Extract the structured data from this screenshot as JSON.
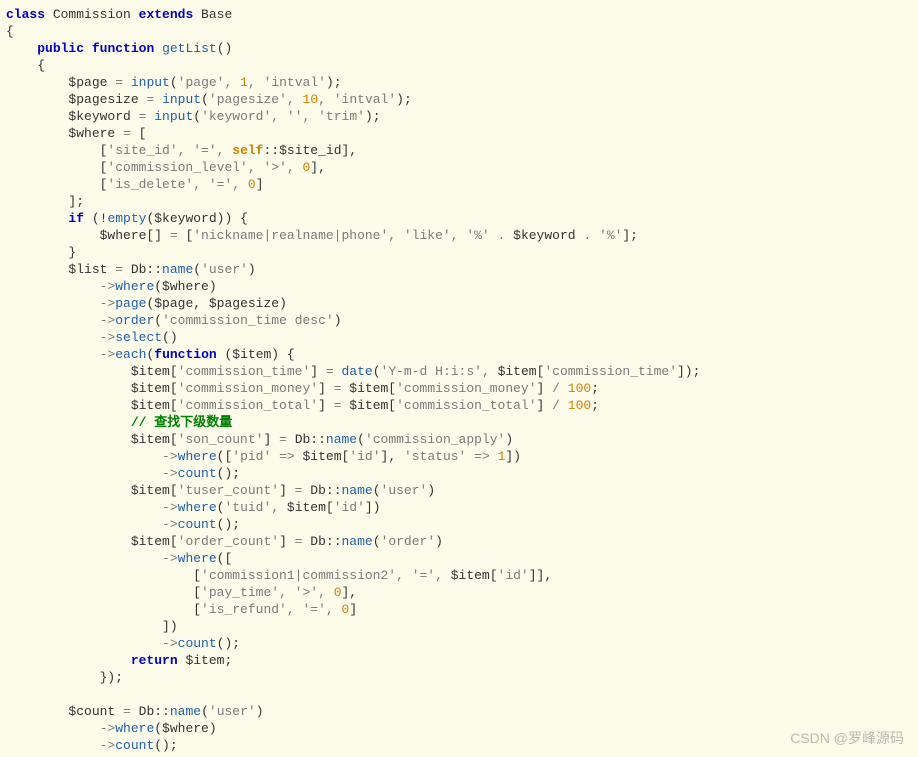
{
  "code": {
    "lines": [
      [
        {
          "c": "kw",
          "t": "class"
        },
        {
          "c": "p",
          "t": " Commission "
        },
        {
          "c": "kw",
          "t": "extends"
        },
        {
          "c": "p",
          "t": " Base"
        }
      ],
      [
        {
          "c": "p",
          "t": "{"
        }
      ],
      [
        {
          "c": "p",
          "t": "    "
        },
        {
          "c": "kw",
          "t": "public"
        },
        {
          "c": "p",
          "t": " "
        },
        {
          "c": "kw",
          "t": "function"
        },
        {
          "c": "p",
          "t": " "
        },
        {
          "c": "fn",
          "t": "getList"
        },
        {
          "c": "p",
          "t": "()"
        }
      ],
      [
        {
          "c": "p",
          "t": "    {"
        }
      ],
      [
        {
          "c": "p",
          "t": "        $page "
        },
        {
          "c": "gy",
          "t": "="
        },
        {
          "c": "p",
          "t": " "
        },
        {
          "c": "fn",
          "t": "input"
        },
        {
          "c": "p",
          "t": "("
        },
        {
          "c": "str",
          "t": "'page'"
        },
        {
          "c": "gy",
          "t": ", "
        },
        {
          "c": "num",
          "t": "1"
        },
        {
          "c": "gy",
          "t": ", "
        },
        {
          "c": "str",
          "t": "'intval'"
        },
        {
          "c": "p",
          "t": ");"
        }
      ],
      [
        {
          "c": "p",
          "t": "        $pagesize "
        },
        {
          "c": "gy",
          "t": "="
        },
        {
          "c": "p",
          "t": " "
        },
        {
          "c": "fn",
          "t": "input"
        },
        {
          "c": "p",
          "t": "("
        },
        {
          "c": "str",
          "t": "'pagesize'"
        },
        {
          "c": "gy",
          "t": ", "
        },
        {
          "c": "num",
          "t": "10"
        },
        {
          "c": "gy",
          "t": ", "
        },
        {
          "c": "str",
          "t": "'intval'"
        },
        {
          "c": "p",
          "t": ");"
        }
      ],
      [
        {
          "c": "p",
          "t": "        $keyword "
        },
        {
          "c": "gy",
          "t": "="
        },
        {
          "c": "p",
          "t": " "
        },
        {
          "c": "fn",
          "t": "input"
        },
        {
          "c": "p",
          "t": "("
        },
        {
          "c": "str",
          "t": "'keyword'"
        },
        {
          "c": "gy",
          "t": ", "
        },
        {
          "c": "str",
          "t": "''"
        },
        {
          "c": "gy",
          "t": ", "
        },
        {
          "c": "str",
          "t": "'trim'"
        },
        {
          "c": "p",
          "t": ");"
        }
      ],
      [
        {
          "c": "p",
          "t": "        $where "
        },
        {
          "c": "gy",
          "t": "="
        },
        {
          "c": "p",
          "t": " ["
        }
      ],
      [
        {
          "c": "p",
          "t": "            ["
        },
        {
          "c": "str",
          "t": "'site_id'"
        },
        {
          "c": "gy",
          "t": ", "
        },
        {
          "c": "str",
          "t": "'='"
        },
        {
          "c": "gy",
          "t": ", "
        },
        {
          "c": "or",
          "t": "self"
        },
        {
          "c": "p",
          "t": "::$site_id],"
        }
      ],
      [
        {
          "c": "p",
          "t": "            ["
        },
        {
          "c": "str",
          "t": "'commission_level'"
        },
        {
          "c": "gy",
          "t": ", "
        },
        {
          "c": "str",
          "t": "'>'"
        },
        {
          "c": "gy",
          "t": ", "
        },
        {
          "c": "num",
          "t": "0"
        },
        {
          "c": "p",
          "t": "],"
        }
      ],
      [
        {
          "c": "p",
          "t": "            ["
        },
        {
          "c": "str",
          "t": "'is_delete'"
        },
        {
          "c": "gy",
          "t": ", "
        },
        {
          "c": "str",
          "t": "'='"
        },
        {
          "c": "gy",
          "t": ", "
        },
        {
          "c": "num",
          "t": "0"
        },
        {
          "c": "p",
          "t": "]"
        }
      ],
      [
        {
          "c": "p",
          "t": "        ];"
        }
      ],
      [
        {
          "c": "p",
          "t": "        "
        },
        {
          "c": "kw",
          "t": "if"
        },
        {
          "c": "p",
          "t": " (!"
        },
        {
          "c": "fn",
          "t": "empty"
        },
        {
          "c": "p",
          "t": "($keyword)) {"
        }
      ],
      [
        {
          "c": "p",
          "t": "            $where[] "
        },
        {
          "c": "gy",
          "t": "="
        },
        {
          "c": "p",
          "t": " ["
        },
        {
          "c": "str",
          "t": "'nickname|realname|phone'"
        },
        {
          "c": "gy",
          "t": ", "
        },
        {
          "c": "str",
          "t": "'like'"
        },
        {
          "c": "gy",
          "t": ", "
        },
        {
          "c": "str",
          "t": "'%'"
        },
        {
          "c": "gy",
          "t": " . "
        },
        {
          "c": "p",
          "t": "$keyword"
        },
        {
          "c": "gy",
          "t": " . "
        },
        {
          "c": "str",
          "t": "'%'"
        },
        {
          "c": "p",
          "t": "];"
        }
      ],
      [
        {
          "c": "p",
          "t": "        }"
        }
      ],
      [
        {
          "c": "p",
          "t": "        $list "
        },
        {
          "c": "gy",
          "t": "="
        },
        {
          "c": "p",
          "t": " Db::"
        },
        {
          "c": "fn",
          "t": "name"
        },
        {
          "c": "p",
          "t": "("
        },
        {
          "c": "str",
          "t": "'user'"
        },
        {
          "c": "p",
          "t": ")"
        }
      ],
      [
        {
          "c": "p",
          "t": "            "
        },
        {
          "c": "gy",
          "t": "->"
        },
        {
          "c": "fn",
          "t": "where"
        },
        {
          "c": "p",
          "t": "($where)"
        }
      ],
      [
        {
          "c": "p",
          "t": "            "
        },
        {
          "c": "gy",
          "t": "->"
        },
        {
          "c": "fn",
          "t": "page"
        },
        {
          "c": "p",
          "t": "($page, $pagesize)"
        }
      ],
      [
        {
          "c": "p",
          "t": "            "
        },
        {
          "c": "gy",
          "t": "->"
        },
        {
          "c": "fn",
          "t": "order"
        },
        {
          "c": "p",
          "t": "("
        },
        {
          "c": "str",
          "t": "'commission_time desc'"
        },
        {
          "c": "p",
          "t": ")"
        }
      ],
      [
        {
          "c": "p",
          "t": "            "
        },
        {
          "c": "gy",
          "t": "->"
        },
        {
          "c": "fn",
          "t": "select"
        },
        {
          "c": "p",
          "t": "()"
        }
      ],
      [
        {
          "c": "p",
          "t": "            "
        },
        {
          "c": "gy",
          "t": "->"
        },
        {
          "c": "fn",
          "t": "each"
        },
        {
          "c": "p",
          "t": "("
        },
        {
          "c": "kw",
          "t": "function"
        },
        {
          "c": "p",
          "t": " ($item) {"
        }
      ],
      [
        {
          "c": "p",
          "t": "                $item["
        },
        {
          "c": "str",
          "t": "'commission_time'"
        },
        {
          "c": "p",
          "t": "] "
        },
        {
          "c": "gy",
          "t": "="
        },
        {
          "c": "p",
          "t": " "
        },
        {
          "c": "fn",
          "t": "date"
        },
        {
          "c": "p",
          "t": "("
        },
        {
          "c": "str",
          "t": "'Y-m-d H:i:s'"
        },
        {
          "c": "gy",
          "t": ", "
        },
        {
          "c": "p",
          "t": "$item["
        },
        {
          "c": "str",
          "t": "'commission_time'"
        },
        {
          "c": "p",
          "t": "]);"
        }
      ],
      [
        {
          "c": "p",
          "t": "                $item["
        },
        {
          "c": "str",
          "t": "'commission_money'"
        },
        {
          "c": "p",
          "t": "] "
        },
        {
          "c": "gy",
          "t": "="
        },
        {
          "c": "p",
          "t": " $item["
        },
        {
          "c": "str",
          "t": "'commission_money'"
        },
        {
          "c": "p",
          "t": "] "
        },
        {
          "c": "gy",
          "t": "/"
        },
        {
          "c": "p",
          "t": " "
        },
        {
          "c": "num",
          "t": "100"
        },
        {
          "c": "p",
          "t": ";"
        }
      ],
      [
        {
          "c": "p",
          "t": "                $item["
        },
        {
          "c": "str",
          "t": "'commission_total'"
        },
        {
          "c": "p",
          "t": "] "
        },
        {
          "c": "gy",
          "t": "="
        },
        {
          "c": "p",
          "t": " $item["
        },
        {
          "c": "str",
          "t": "'commission_total'"
        },
        {
          "c": "p",
          "t": "] "
        },
        {
          "c": "gy",
          "t": "/"
        },
        {
          "c": "p",
          "t": " "
        },
        {
          "c": "num",
          "t": "100"
        },
        {
          "c": "p",
          "t": ";"
        }
      ],
      [
        {
          "c": "p",
          "t": "                "
        },
        {
          "c": "cmt",
          "t": "// 查找下级数量"
        }
      ],
      [
        {
          "c": "p",
          "t": "                $item["
        },
        {
          "c": "str",
          "t": "'son_count'"
        },
        {
          "c": "p",
          "t": "] "
        },
        {
          "c": "gy",
          "t": "="
        },
        {
          "c": "p",
          "t": " Db::"
        },
        {
          "c": "fn",
          "t": "name"
        },
        {
          "c": "p",
          "t": "("
        },
        {
          "c": "str",
          "t": "'commission_apply'"
        },
        {
          "c": "p",
          "t": ")"
        }
      ],
      [
        {
          "c": "p",
          "t": "                    "
        },
        {
          "c": "gy",
          "t": "->"
        },
        {
          "c": "fn",
          "t": "where"
        },
        {
          "c": "p",
          "t": "(["
        },
        {
          "c": "str",
          "t": "'pid'"
        },
        {
          "c": "p",
          "t": " "
        },
        {
          "c": "gy",
          "t": "=>"
        },
        {
          "c": "p",
          "t": " $item["
        },
        {
          "c": "str",
          "t": "'id'"
        },
        {
          "c": "p",
          "t": "], "
        },
        {
          "c": "str",
          "t": "'status'"
        },
        {
          "c": "p",
          "t": " "
        },
        {
          "c": "gy",
          "t": "=>"
        },
        {
          "c": "p",
          "t": " "
        },
        {
          "c": "num",
          "t": "1"
        },
        {
          "c": "p",
          "t": "])"
        }
      ],
      [
        {
          "c": "p",
          "t": "                    "
        },
        {
          "c": "gy",
          "t": "->"
        },
        {
          "c": "fn",
          "t": "count"
        },
        {
          "c": "p",
          "t": "();"
        }
      ],
      [
        {
          "c": "p",
          "t": "                $item["
        },
        {
          "c": "str",
          "t": "'tuser_count'"
        },
        {
          "c": "p",
          "t": "] "
        },
        {
          "c": "gy",
          "t": "="
        },
        {
          "c": "p",
          "t": " Db::"
        },
        {
          "c": "fn",
          "t": "name"
        },
        {
          "c": "p",
          "t": "("
        },
        {
          "c": "str",
          "t": "'user'"
        },
        {
          "c": "p",
          "t": ")"
        }
      ],
      [
        {
          "c": "p",
          "t": "                    "
        },
        {
          "c": "gy",
          "t": "->"
        },
        {
          "c": "fn",
          "t": "where"
        },
        {
          "c": "p",
          "t": "("
        },
        {
          "c": "str",
          "t": "'tuid'"
        },
        {
          "c": "gy",
          "t": ", "
        },
        {
          "c": "p",
          "t": "$item["
        },
        {
          "c": "str",
          "t": "'id'"
        },
        {
          "c": "p",
          "t": "])"
        }
      ],
      [
        {
          "c": "p",
          "t": "                    "
        },
        {
          "c": "gy",
          "t": "->"
        },
        {
          "c": "fn",
          "t": "count"
        },
        {
          "c": "p",
          "t": "();"
        }
      ],
      [
        {
          "c": "p",
          "t": "                $item["
        },
        {
          "c": "str",
          "t": "'order_count'"
        },
        {
          "c": "p",
          "t": "] "
        },
        {
          "c": "gy",
          "t": "="
        },
        {
          "c": "p",
          "t": " Db::"
        },
        {
          "c": "fn",
          "t": "name"
        },
        {
          "c": "p",
          "t": "("
        },
        {
          "c": "str",
          "t": "'order'"
        },
        {
          "c": "p",
          "t": ")"
        }
      ],
      [
        {
          "c": "p",
          "t": "                    "
        },
        {
          "c": "gy",
          "t": "->"
        },
        {
          "c": "fn",
          "t": "where"
        },
        {
          "c": "p",
          "t": "(["
        }
      ],
      [
        {
          "c": "p",
          "t": "                        ["
        },
        {
          "c": "str",
          "t": "'commission1|commission2'"
        },
        {
          "c": "gy",
          "t": ", "
        },
        {
          "c": "str",
          "t": "'='"
        },
        {
          "c": "gy",
          "t": ", "
        },
        {
          "c": "p",
          "t": "$item["
        },
        {
          "c": "str",
          "t": "'id'"
        },
        {
          "c": "p",
          "t": "]],"
        }
      ],
      [
        {
          "c": "p",
          "t": "                        ["
        },
        {
          "c": "str",
          "t": "'pay_time'"
        },
        {
          "c": "gy",
          "t": ", "
        },
        {
          "c": "str",
          "t": "'>'"
        },
        {
          "c": "gy",
          "t": ", "
        },
        {
          "c": "num",
          "t": "0"
        },
        {
          "c": "p",
          "t": "],"
        }
      ],
      [
        {
          "c": "p",
          "t": "                        ["
        },
        {
          "c": "str",
          "t": "'is_refund'"
        },
        {
          "c": "gy",
          "t": ", "
        },
        {
          "c": "str",
          "t": "'='"
        },
        {
          "c": "gy",
          "t": ", "
        },
        {
          "c": "num",
          "t": "0"
        },
        {
          "c": "p",
          "t": "]"
        }
      ],
      [
        {
          "c": "p",
          "t": "                    ])"
        }
      ],
      [
        {
          "c": "p",
          "t": "                    "
        },
        {
          "c": "gy",
          "t": "->"
        },
        {
          "c": "fn",
          "t": "count"
        },
        {
          "c": "p",
          "t": "();"
        }
      ],
      [
        {
          "c": "p",
          "t": "                "
        },
        {
          "c": "kw",
          "t": "return"
        },
        {
          "c": "p",
          "t": " $item;"
        }
      ],
      [
        {
          "c": "p",
          "t": "            });"
        }
      ],
      [
        {
          "c": "p",
          "t": ""
        }
      ],
      [
        {
          "c": "p",
          "t": "        $count "
        },
        {
          "c": "gy",
          "t": "="
        },
        {
          "c": "p",
          "t": " Db::"
        },
        {
          "c": "fn",
          "t": "name"
        },
        {
          "c": "p",
          "t": "("
        },
        {
          "c": "str",
          "t": "'user'"
        },
        {
          "c": "p",
          "t": ")"
        }
      ],
      [
        {
          "c": "p",
          "t": "            "
        },
        {
          "c": "gy",
          "t": "->"
        },
        {
          "c": "fn",
          "t": "where"
        },
        {
          "c": "p",
          "t": "($where)"
        }
      ],
      [
        {
          "c": "p",
          "t": "            "
        },
        {
          "c": "gy",
          "t": "->"
        },
        {
          "c": "fn",
          "t": "count"
        },
        {
          "c": "p",
          "t": "();"
        }
      ]
    ]
  },
  "watermark": "CSDN @罗峰源码"
}
